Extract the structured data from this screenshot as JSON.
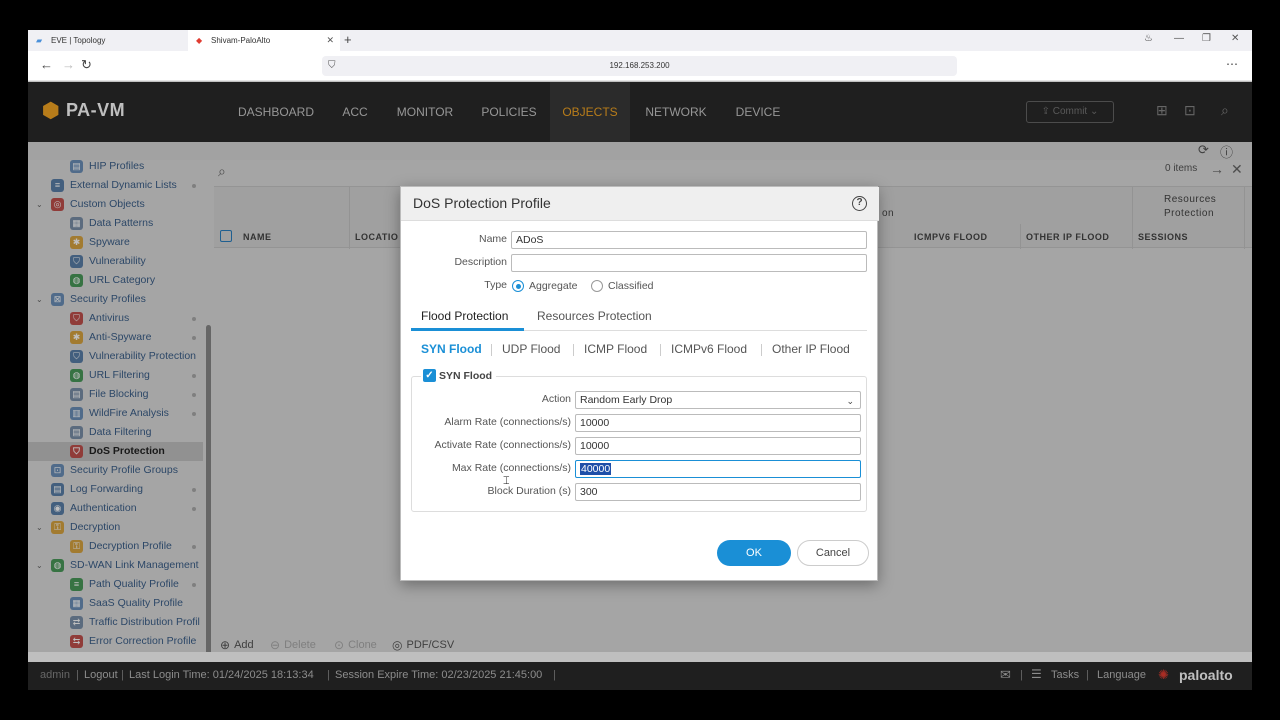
{
  "browser": {
    "tabs": [
      {
        "title": "EVE | Topology"
      },
      {
        "title": "Shivam-PaloAlto"
      }
    ],
    "address": "192.168.253.200"
  },
  "app": {
    "logo": "PA-VM",
    "nav": [
      "DASHBOARD",
      "ACC",
      "MONITOR",
      "POLICIES",
      "OBJECTS",
      "NETWORK",
      "DEVICE"
    ],
    "active_nav": "OBJECTS",
    "commit_label": "Commit"
  },
  "sidebar": {
    "items": [
      {
        "label": "HIP Profiles"
      },
      {
        "label": "External Dynamic Lists"
      },
      {
        "label": "Custom Objects"
      },
      {
        "label": "Data Patterns"
      },
      {
        "label": "Spyware"
      },
      {
        "label": "Vulnerability"
      },
      {
        "label": "URL Category"
      },
      {
        "label": "Security Profiles"
      },
      {
        "label": "Antivirus"
      },
      {
        "label": "Anti-Spyware"
      },
      {
        "label": "Vulnerability Protection"
      },
      {
        "label": "URL Filtering"
      },
      {
        "label": "File Blocking"
      },
      {
        "label": "WildFire Analysis"
      },
      {
        "label": "Data Filtering"
      },
      {
        "label": "DoS Protection"
      },
      {
        "label": "Security Profile Groups"
      },
      {
        "label": "Log Forwarding"
      },
      {
        "label": "Authentication"
      },
      {
        "label": "Decryption"
      },
      {
        "label": "Decryption Profile"
      },
      {
        "label": "SD-WAN Link Management"
      },
      {
        "label": "Path Quality Profile"
      },
      {
        "label": "SaaS Quality Profile"
      },
      {
        "label": "Traffic Distribution Profil"
      },
      {
        "label": "Error Correction Profile"
      }
    ]
  },
  "main": {
    "items_count": "0 items",
    "columns": {
      "name": "NAME",
      "location": "LOCATIO",
      "flood_suffix": "on",
      "icmpv6": "ICMPV6 FLOOD",
      "other_ip": "OTHER IP FLOOD",
      "sessions": "SESSIONS",
      "resources_protection_line1": "Resources",
      "resources_protection_line2": "Protection"
    },
    "bottom": {
      "add": "Add",
      "delete": "Delete",
      "clone": "Clone",
      "pdf_csv": "PDF/CSV"
    }
  },
  "status": {
    "user": "admin",
    "logout": "Logout",
    "last_login": "Last Login Time: 01/24/2025 18:13:34",
    "session_expire": "Session Expire Time: 02/23/2025 21:45:00",
    "tasks": "Tasks",
    "language": "Language",
    "brand": "paloalto"
  },
  "dialog": {
    "title": "DoS Protection Profile",
    "name_label": "Name",
    "name_value": "ADoS",
    "description_label": "Description",
    "description_value": "",
    "type_label": "Type",
    "type_options": [
      "Aggregate",
      "Classified"
    ],
    "type_selected": "Aggregate",
    "tabs": [
      "Flood Protection",
      "Resources Protection"
    ],
    "active_tab": "Flood Protection",
    "subtabs": [
      "SYN Flood",
      "UDP Flood",
      "ICMP Flood",
      "ICMPv6 Flood",
      "Other IP Flood"
    ],
    "active_subtab": "SYN Flood",
    "syn_flood": {
      "checkbox_label": "SYN Flood",
      "checked": true,
      "action_label": "Action",
      "action_value": "Random Early Drop",
      "alarm_rate_label": "Alarm Rate (connections/s)",
      "alarm_rate_value": "10000",
      "activate_rate_label": "Activate Rate (connections/s)",
      "activate_rate_value": "10000",
      "max_rate_label": "Max Rate (connections/s)",
      "max_rate_value": "40000",
      "block_duration_label": "Block Duration (s)",
      "block_duration_value": "300"
    },
    "ok_label": "OK",
    "cancel_label": "Cancel"
  },
  "colors": {
    "accent": "#1a8fd6",
    "nav_active": "#f5a623",
    "header_bg": "#2a2a2a"
  }
}
